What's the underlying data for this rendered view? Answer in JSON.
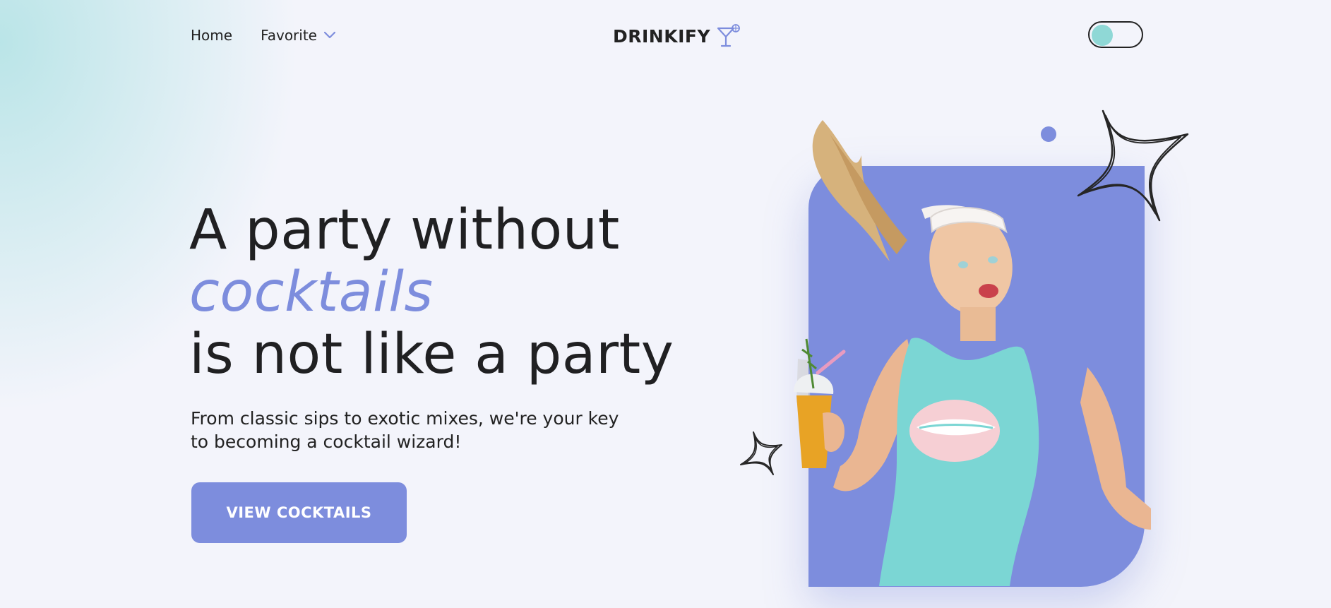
{
  "nav": {
    "home": "Home",
    "favorite": "Favorite"
  },
  "brand": {
    "name": "DRINKIFY"
  },
  "hero": {
    "title_line1": "A party without",
    "title_accent": "cocktails",
    "title_line3": "is not like a party",
    "subtitle": "From classic sips to exotic mixes, we're your key to becoming a cocktail wizard!",
    "cta_label": "VIEW COCKTAILS"
  },
  "theme": {
    "accent": "#7d8ddd",
    "teal": "#8fd8d6",
    "background": "#f3f4fb",
    "text": "#202022"
  },
  "icons": [
    "chevron-down-icon",
    "cocktail-glass-icon",
    "star-outline-icon",
    "dot-icon"
  ]
}
